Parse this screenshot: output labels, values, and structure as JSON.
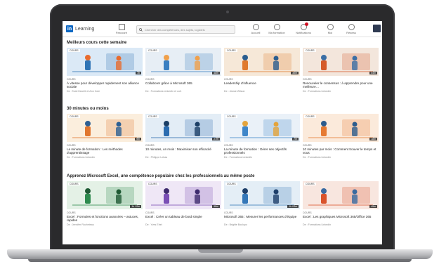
{
  "app": {
    "logo_mark": "in",
    "name": "Learning"
  },
  "nav": {
    "browse": "Parcourir",
    "search_placeholder": "Chercher des compétences, des sujets, logiciels",
    "right": [
      "Accueil",
      "Ma formation",
      "Notifications",
      "Moi",
      "Réseau"
    ],
    "colors": {
      "brand": "#0a66c2",
      "badge": "#d11124"
    }
  },
  "sections": [
    {
      "title": "Meilleurs cours cette semaine",
      "cards": [
        {
          "tag": "COURS",
          "duration": "1h",
          "type": "COURS",
          "title": "À vitesse pour développer rapidement son alliance sociale",
          "author": "De : Todd Dewett et Ann Cole",
          "colors": [
            "#dbe9f6",
            "#2f74b5",
            "#e86b2e"
          ]
        },
        {
          "tag": "COURS",
          "duration": "48m",
          "type": "COURS",
          "title": "Collaborer grâce à Microsoft 365",
          "author": "De : Formations LinkedIn et coll.",
          "colors": [
            "#e7eef5",
            "#3a7fc1",
            "#f0a04b"
          ]
        },
        {
          "tag": "COURS",
          "duration": "35m",
          "type": "COURS",
          "title": "Leadership d'influence",
          "author": "De : Jessie Wilson",
          "colors": [
            "#f6e8d8",
            "#e07a2d",
            "#2a5d8f"
          ]
        },
        {
          "tag": "COURS",
          "duration": "54m",
          "type": "COURS",
          "title": "Renouveler le consensus : à apprendre pour une meilleure…",
          "author": "De : Formations LinkedIn",
          "colors": [
            "#f3e6dc",
            "#d55b2a",
            "#3b6ea5"
          ]
        }
      ]
    },
    {
      "title": "30 minutes ou moins",
      "cards": [
        {
          "tag": "COURS",
          "duration": "9m",
          "type": "COURS",
          "title": "La minute de formation : Les méthodes d'apprentissage",
          "author": "De : Formations LinkedIn",
          "colors": [
            "#fbeedd",
            "#e0762f",
            "#2d5f93"
          ]
        },
        {
          "tag": "COURS",
          "duration": "27m",
          "type": "COURS",
          "title": "10 minutes, un mois : Maximiser son efficacité",
          "author": "De : Philippe Lebas",
          "colors": [
            "#e3edf6",
            "#2b6cb0",
            "#1c3f66"
          ]
        },
        {
          "tag": "COURS",
          "duration": "7m",
          "type": "COURS",
          "title": "La minute de formation : Gérer ses objectifs professionnels",
          "author": "De : Formations LinkedIn",
          "colors": [
            "#eaf1f8",
            "#3f86c9",
            "#e4a43c"
          ]
        },
        {
          "tag": "COURS",
          "duration": "18m",
          "type": "COURS",
          "title": "10 minutes par mois : Comment trouver le temps et vous",
          "author": "De : Formations LinkedIn",
          "colors": [
            "#fbeadb",
            "#e67a32",
            "#2c5c8d"
          ]
        }
      ]
    },
    {
      "title": "Apprenez Microsoft Excel, une compétence populaire chez les professionnels au même poste",
      "cards": [
        {
          "tag": "COURS",
          "duration": "1h 12m",
          "type": "COURS",
          "title": "Excel : Formules et fonctions avancées – astuces, rapides",
          "author": "De : Jennifer Rocheteau",
          "colors": [
            "#e4f1e6",
            "#2e8b4e",
            "#1f5a34"
          ]
        },
        {
          "tag": "COURS",
          "duration": "58m",
          "type": "COURS",
          "title": "Excel : Créer un tableau de bord simple",
          "author": "De : Yves Ertel",
          "colors": [
            "#efe7f6",
            "#7a4fb5",
            "#3e2b6e"
          ]
        },
        {
          "tag": "COURS",
          "duration": "1h 03m",
          "type": "COURS",
          "title": "Microsoft 365 : Mesurer les performances d'équipe",
          "author": "De : Brigitte Bouloyo",
          "colors": [
            "#e4eef6",
            "#3477b8",
            "#1e3f6a"
          ]
        },
        {
          "tag": "COURS",
          "duration": "45m",
          "type": "COURS",
          "title": "Excel : Les graphiques Microsoft 365/Office 365",
          "author": "De : Formations LinkedIn",
          "colors": [
            "#f8e6df",
            "#d9532b",
            "#3a6aa0"
          ]
        }
      ]
    }
  ]
}
